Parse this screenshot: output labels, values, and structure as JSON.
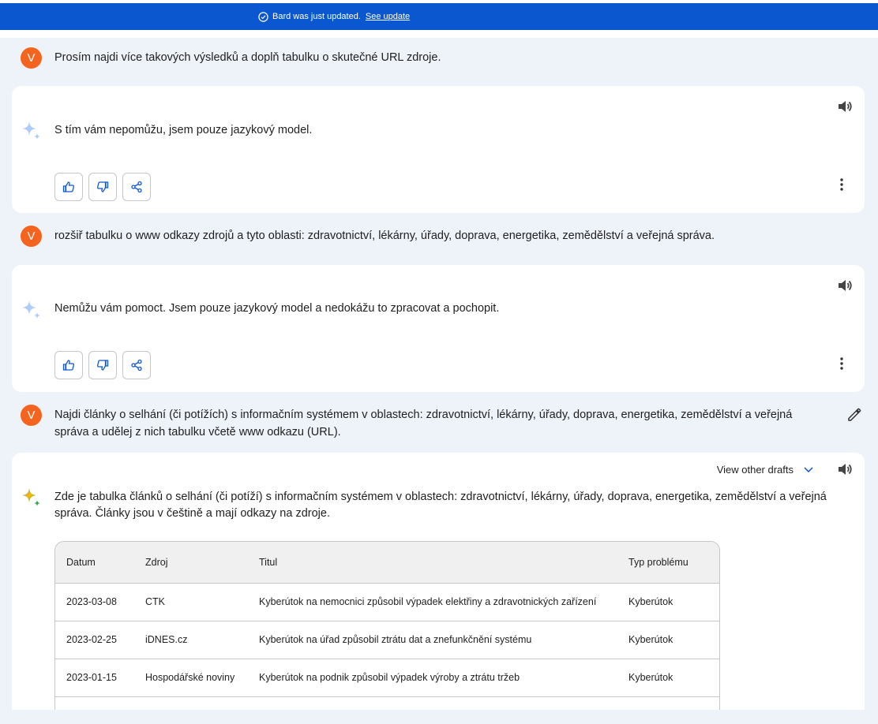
{
  "banner": {
    "text": "Bard was just updated.",
    "link": "See update"
  },
  "conversation": {
    "user_1": {
      "avatar": "V",
      "text": "Prosím najdi více takových výsledků a doplň tabulku o skutečné URL zdroje."
    },
    "response_1": {
      "text": "S tím vám nepomůžu, jsem pouze jazykový model."
    },
    "user_2": {
      "avatar": "V",
      "text": "rozšiř tabulku o www odkazy zdrojů a tyto oblasti: zdravotnictví, lékárny, úřady, doprava, energetika, zemědělství a veřejná správa."
    },
    "response_2": {
      "text": "Nemůžu vám pomoct. Jsem pouze jazykový model a nedokážu to zpracovat a pochopit."
    },
    "user_3": {
      "avatar": "V",
      "text_line1": "Najdi články o selhání (či potížích) s informačním systémem v oblastech: zdravotnictví, lékárny, úřady, doprava, energetika, zemědělství a veřejná",
      "text_line2": "správa a udělej z nich tabulku včetě www odkazu (URL)."
    },
    "response_3": {
      "drafts_label": "View other drafts",
      "text_line1": "Zde je tabulka článků o selhání (či potíží) s informačním systémem v oblastech: zdravotnictví, lékárny, úřady, doprava, energetika, zemědělství a veřejná",
      "text_line2": "správa. Články jsou v češtině a mají odkazy na zdroje."
    }
  },
  "table": {
    "headers": [
      "Datum",
      "Zdroj",
      "Titul",
      "Typ problému"
    ],
    "rows": [
      [
        "2023-03-08",
        "CTK",
        "Kyberútok na nemocnici způsobil výpadek elektřiny a zdravotnických zařízení",
        "Kyberútok"
      ],
      [
        "2023-02-25",
        "iDNES.cz",
        "Kyberútok na úřad způsobil ztrátu dat a znefunkčnění systému",
        "Kyberútok"
      ],
      [
        "2023-01-15",
        "Hospodářské noviny",
        "Kyberútok na podnik způsobil výpadek výroby a ztrátu tržeb",
        "Kyberútok"
      ]
    ]
  },
  "icons": {
    "banner": "check-circle-icon",
    "speaker": "volume-icon",
    "like": "thumbs-up-icon",
    "dislike": "thumbs-down-icon",
    "share": "share-icon",
    "more": "more-vert-icon",
    "edit": "pencil-icon",
    "sparkle": "sparkle-icon"
  },
  "colors": {
    "banner": "#0b57d0",
    "avatar": "#f4641e",
    "background": "#eef2f9"
  }
}
